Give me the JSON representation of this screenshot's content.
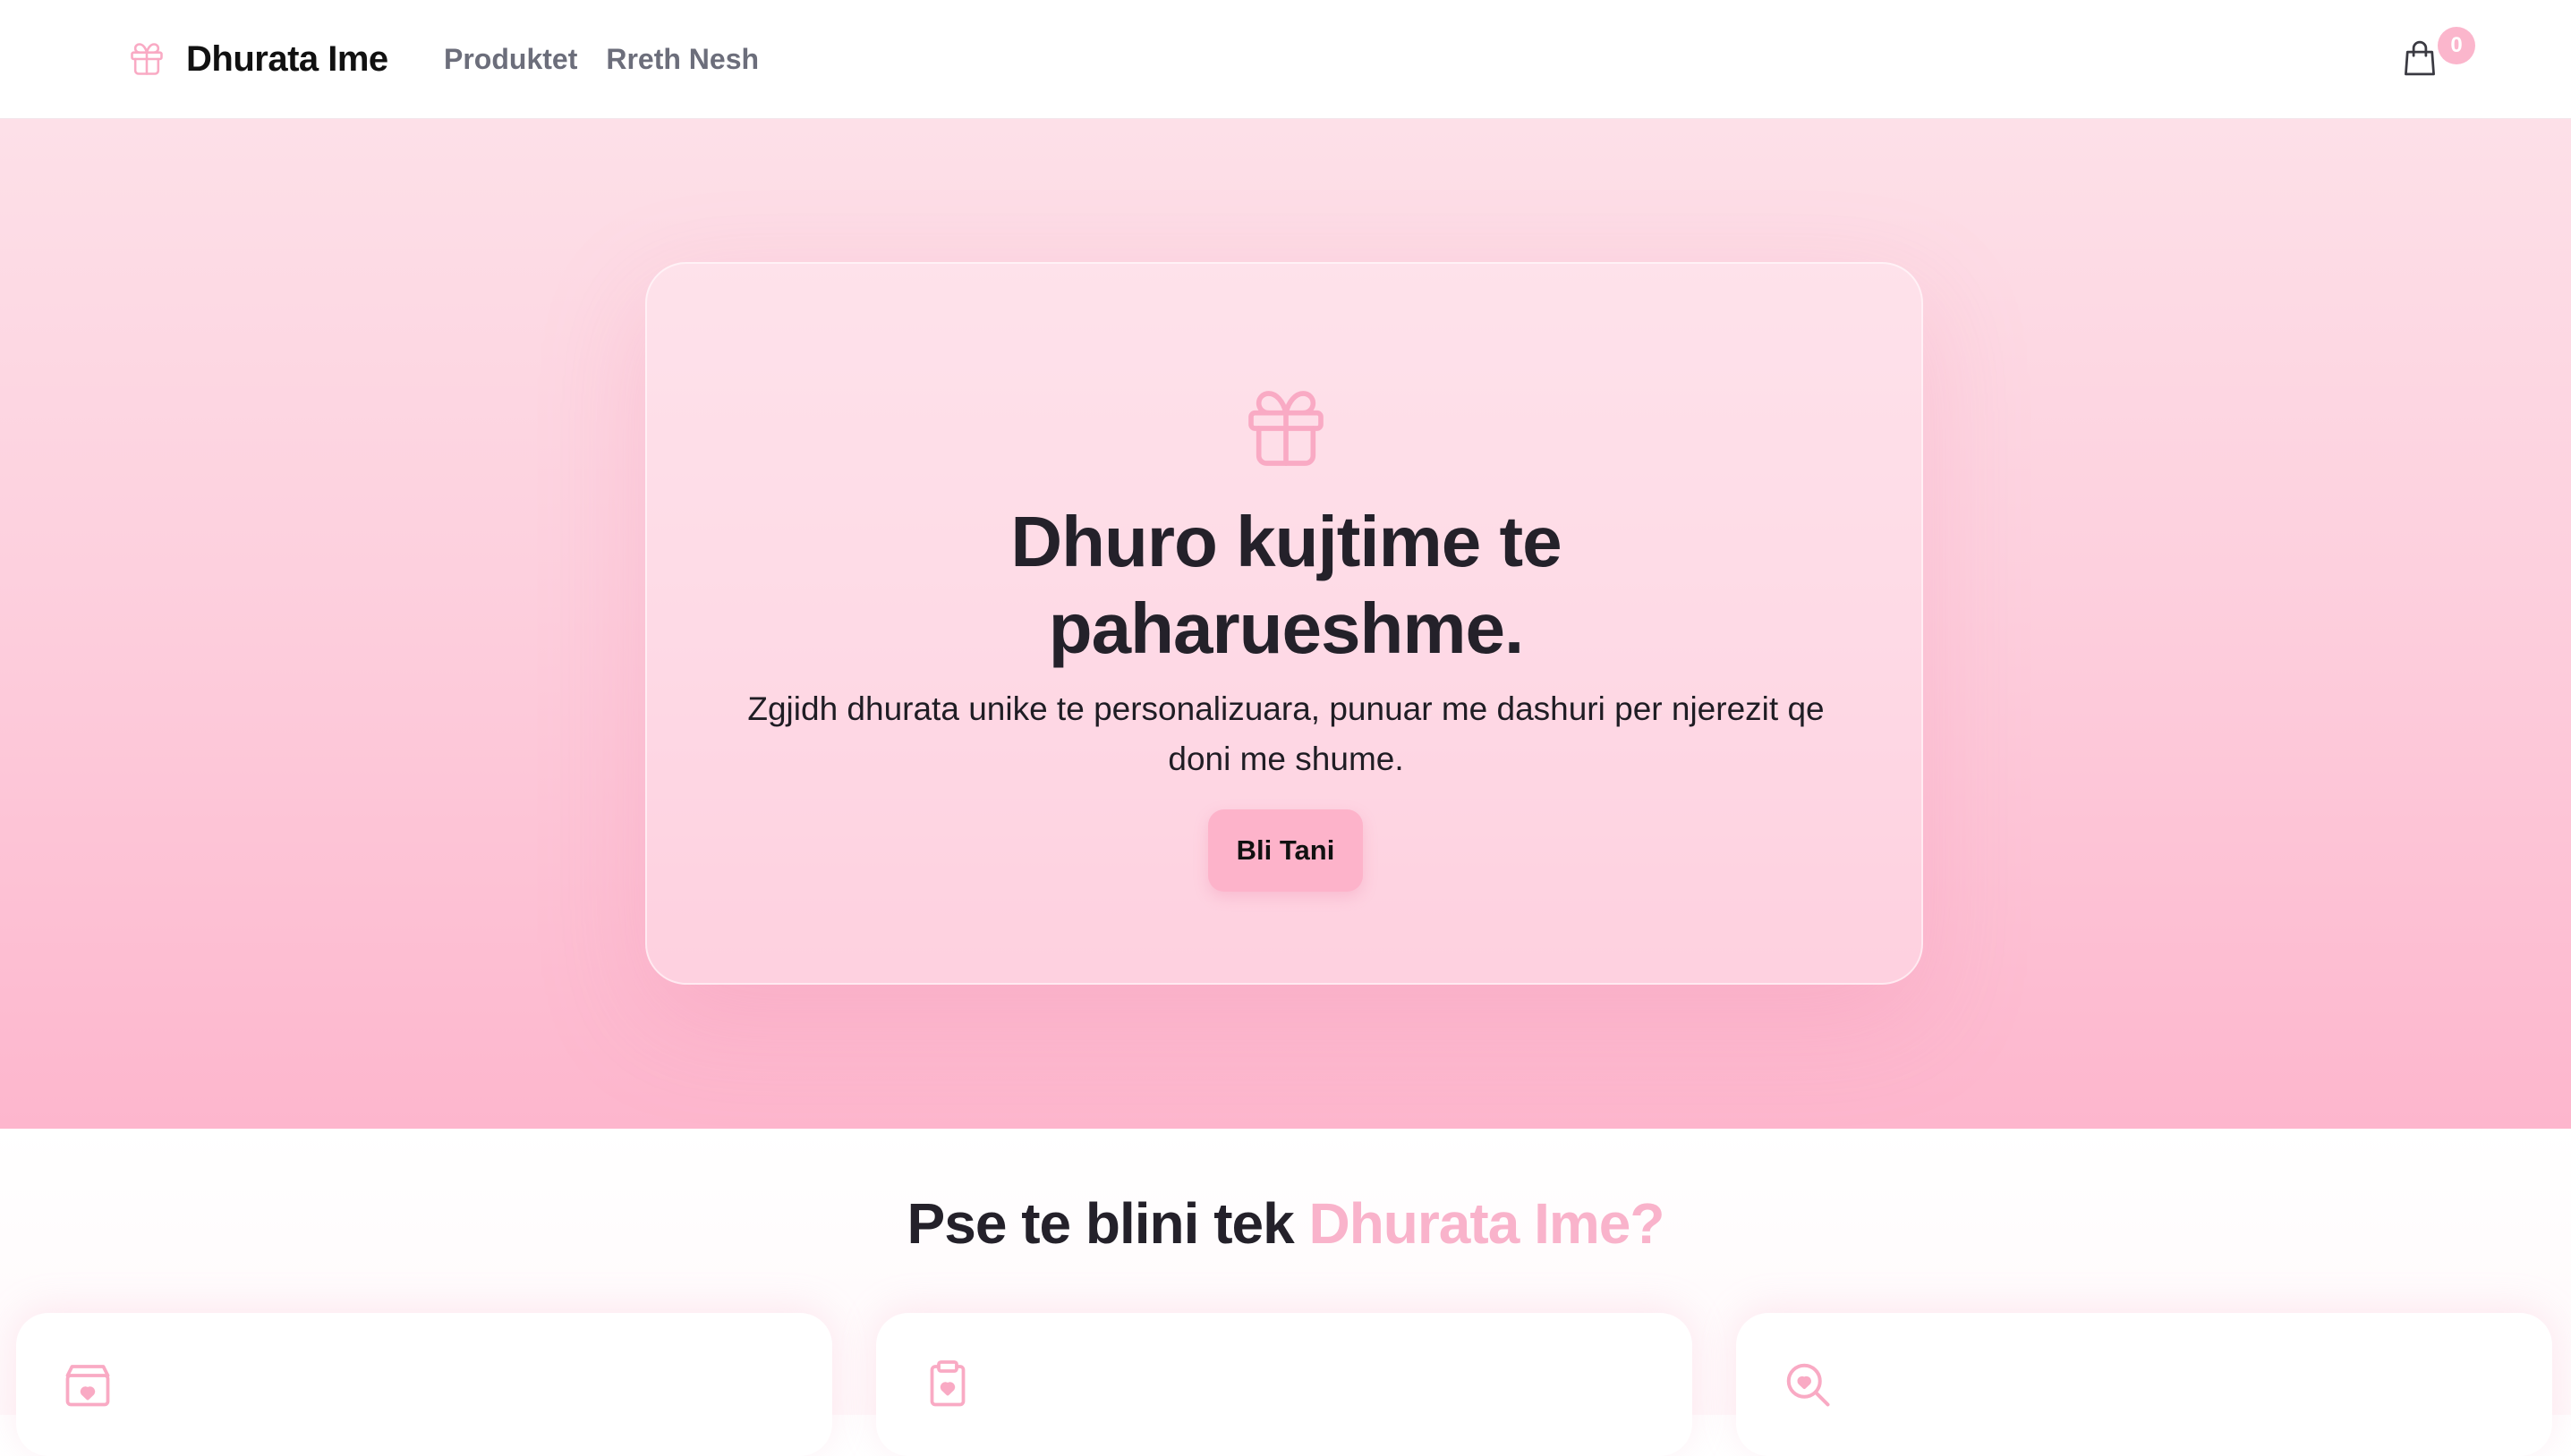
{
  "header": {
    "brand_name": "Dhurata Ime",
    "brand_icon": "gift-icon",
    "nav": [
      {
        "label": "Produktet"
      },
      {
        "label": "Rreth Nesh"
      }
    ],
    "cart": {
      "icon": "shopping-bag-icon",
      "count": "0"
    }
  },
  "hero": {
    "icon": "gift-icon",
    "title_line1": "Dhuro kujtime te",
    "title_line2": "paharueshme.",
    "subtitle": "Zgjidh dhurata unike te personalizuara, punuar me dashuri per njerezit qe doni me shume.",
    "cta_label": "Bli Tani"
  },
  "features": {
    "title_prefix": "Pse te blini tek ",
    "title_accent": "Dhurata Ime?",
    "cards": [
      {
        "icon": "box-heart-icon"
      },
      {
        "icon": "clipboard-heart-icon"
      },
      {
        "icon": "search-heart-icon"
      }
    ]
  },
  "colors": {
    "accent_pink": "#fbb6cc",
    "hero_top": "#fde0e8",
    "hero_bottom": "#fdb6cd",
    "text_dark": "#24212a",
    "nav_gray": "#6c6e7b"
  }
}
